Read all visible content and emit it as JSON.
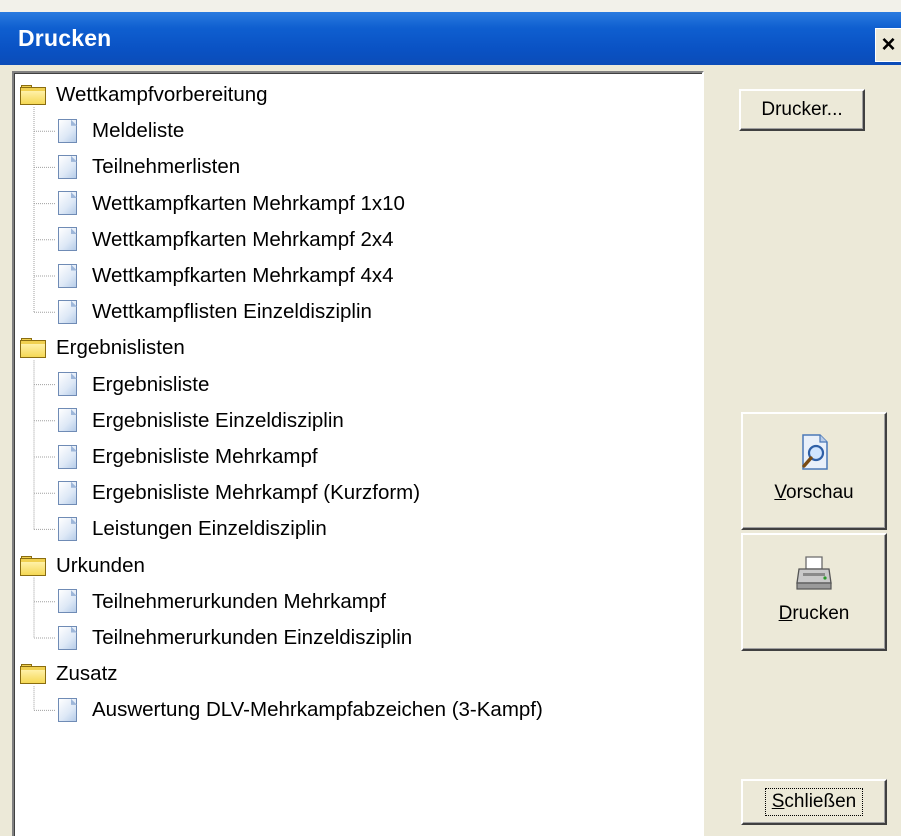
{
  "window": {
    "title": "Drucken",
    "close_label": "×"
  },
  "tree": {
    "groups": [
      {
        "label": "Wettkampfvorbereitung",
        "items": [
          "Meldeliste",
          "Teilnehmerlisten",
          "Wettkampfkarten Mehrkampf 1x10",
          "Wettkampfkarten Mehrkampf 2x4",
          "Wettkampfkarten Mehrkampf 4x4",
          "Wettkampflisten Einzeldisziplin"
        ]
      },
      {
        "label": "Ergebnislisten",
        "items": [
          "Ergebnisliste",
          "Ergebnisliste Einzeldisziplin",
          "Ergebnisliste Mehrkampf",
          "Ergebnisliste Mehrkampf (Kurzform)",
          "Leistungen Einzeldisziplin"
        ]
      },
      {
        "label": "Urkunden",
        "items": [
          "Teilnehmerurkunden Mehrkampf",
          "Teilnehmerurkunden Einzeldisziplin"
        ]
      },
      {
        "label": "Zusatz",
        "items": [
          "Auswertung DLV-Mehrkampfabzeichen (3-Kampf)"
        ]
      }
    ]
  },
  "buttons": {
    "drucker_label": "Drucker...",
    "vorschau_accel": "V",
    "vorschau_rest": "orschau",
    "drucken_accel": "D",
    "drucken_rest": "rucken",
    "schliessen_accel": "S",
    "schliessen_rest": "chließen"
  },
  "icons": {
    "folder": "folder-icon",
    "document": "document-icon",
    "preview": "magnifier-document-icon",
    "print": "printer-icon",
    "close": "close-icon"
  },
  "colors": {
    "titlebar": "#0a52c4",
    "dialog_bg": "#ece9d8",
    "folder": "#f0d050"
  }
}
